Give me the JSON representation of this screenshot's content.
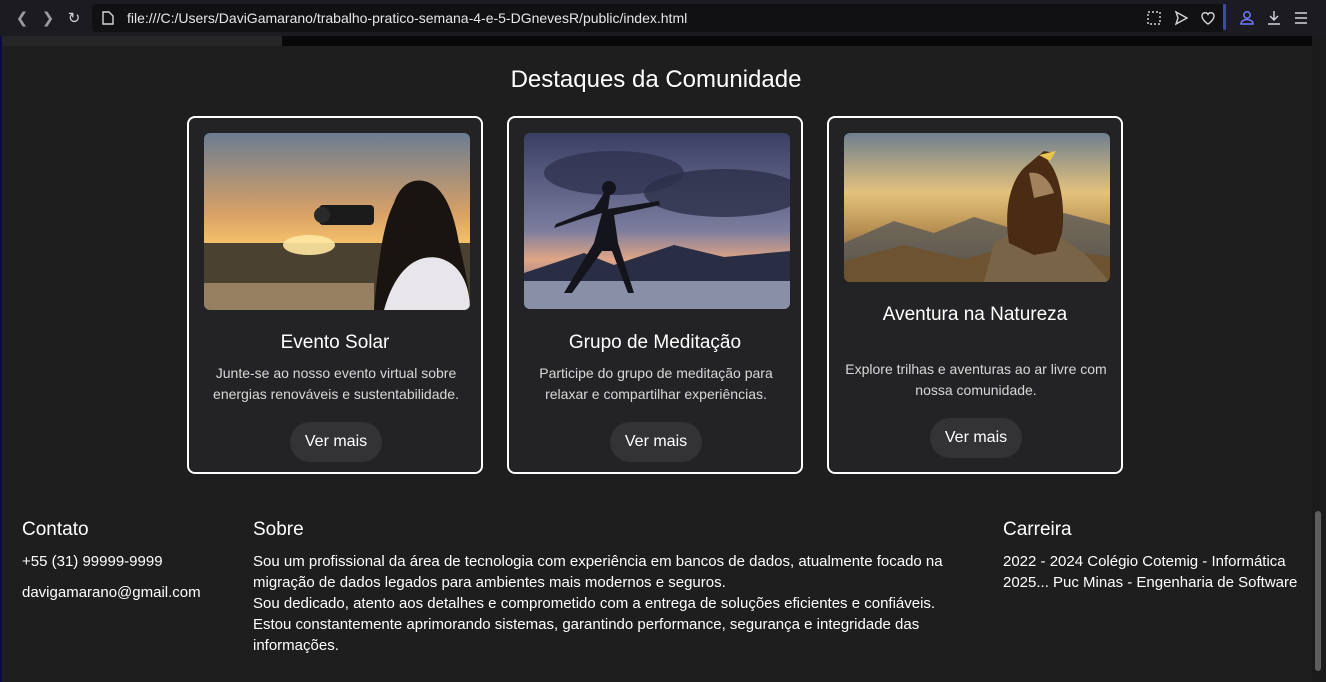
{
  "browser": {
    "url": "file:///C:/Users/DaviGamarano/trabalho-pratico-semana-4-e-5-DGnevesR/public/index.html",
    "icons": [
      "back-icon",
      "forward-icon",
      "reload-icon",
      "page-icon",
      "screenshot-icon",
      "send-icon",
      "heart-icon",
      "account-icon",
      "download-icon",
      "menu-icon"
    ]
  },
  "section": {
    "title": "Destaques da Comunidade"
  },
  "cards": [
    {
      "title": "Evento Solar",
      "text": "Junte-se ao nosso evento virtual sobre energias renováveis e sustentabilidade.",
      "button": "Ver mais"
    },
    {
      "title": "Grupo de Meditação",
      "text": "Participe do grupo de meditação para relaxar e compartilhar experiências.",
      "button": "Ver mais"
    },
    {
      "title": "Aventura na Natureza",
      "text": "Explore trilhas e aventuras ao ar livre com nossa comunidade.",
      "button": "Ver mais"
    }
  ],
  "footer": {
    "contact": {
      "title": "Contato",
      "phone": "+55 (31) 99999-9999",
      "email": "davigamarano@gmail.com"
    },
    "about": {
      "title": "Sobre",
      "line1": "Sou um profissional da área de tecnologia com experiência em bancos de dados, atualmente focado na",
      "line2": "migração de dados legados para ambientes mais modernos e seguros.",
      "line3": "Sou dedicado, atento aos detalhes e comprometido com a entrega de soluções eficientes e confiáveis.",
      "line4": "Estou constantemente aprimorando sistemas, garantindo performance, segurança e integridade das",
      "line5": "informações."
    },
    "career": {
      "title": "Carreira",
      "item1": "2022 - 2024 Colégio Cotemig - Informática",
      "item2": "2025... Puc Minas - Engenharia de Software"
    }
  },
  "colors": {
    "background": "#1e1e1e",
    "card_border": "#ffffff",
    "button_bg": "#333336",
    "browser_accent": "#3f4aa8"
  }
}
